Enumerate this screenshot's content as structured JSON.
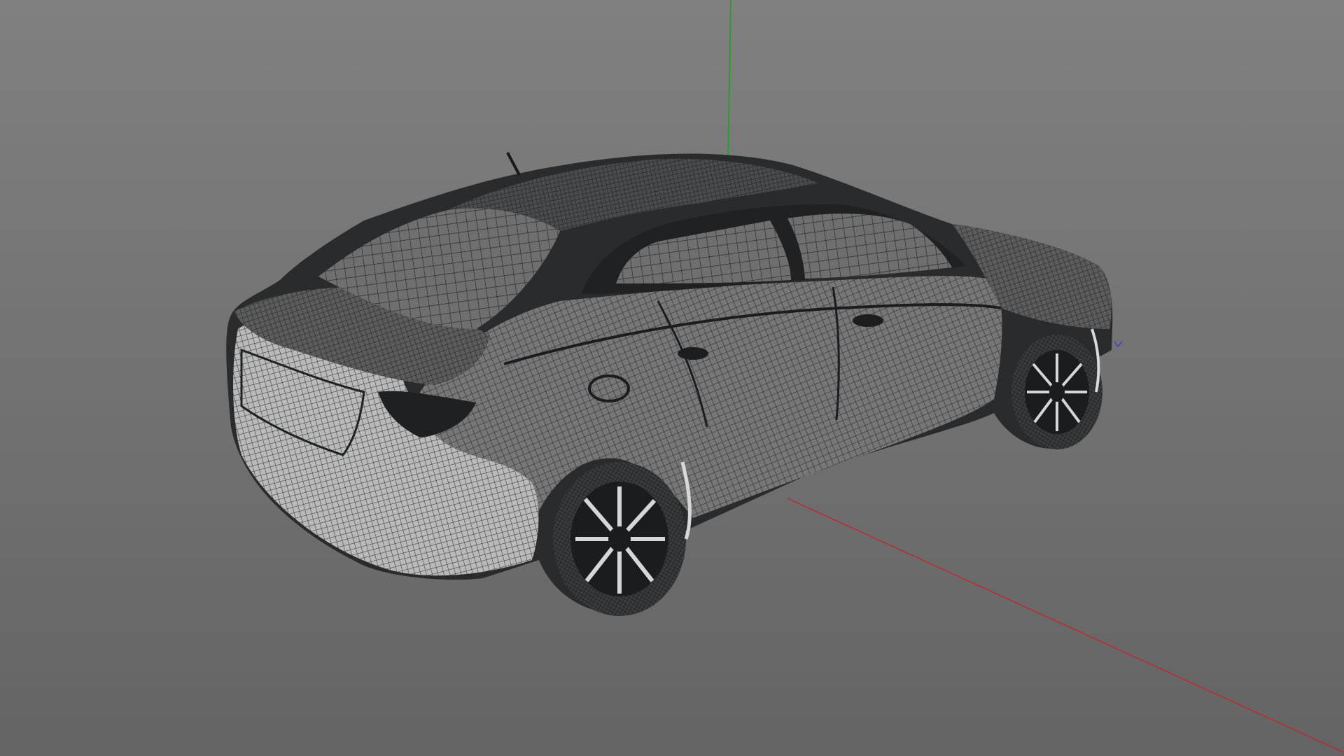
{
  "viewport": {
    "background_top": "#808080",
    "background_bottom": "#646464"
  },
  "axes": {
    "x_axis_color": "#c0282a",
    "y_axis_color": "#2f9a2f",
    "z_axis_color": "#4040d0"
  },
  "model": {
    "display_mode": "wireframe",
    "wire_color": "#2a2b2d",
    "shade_dark": "#1f2022",
    "shade_light": "#c8c8c8"
  }
}
